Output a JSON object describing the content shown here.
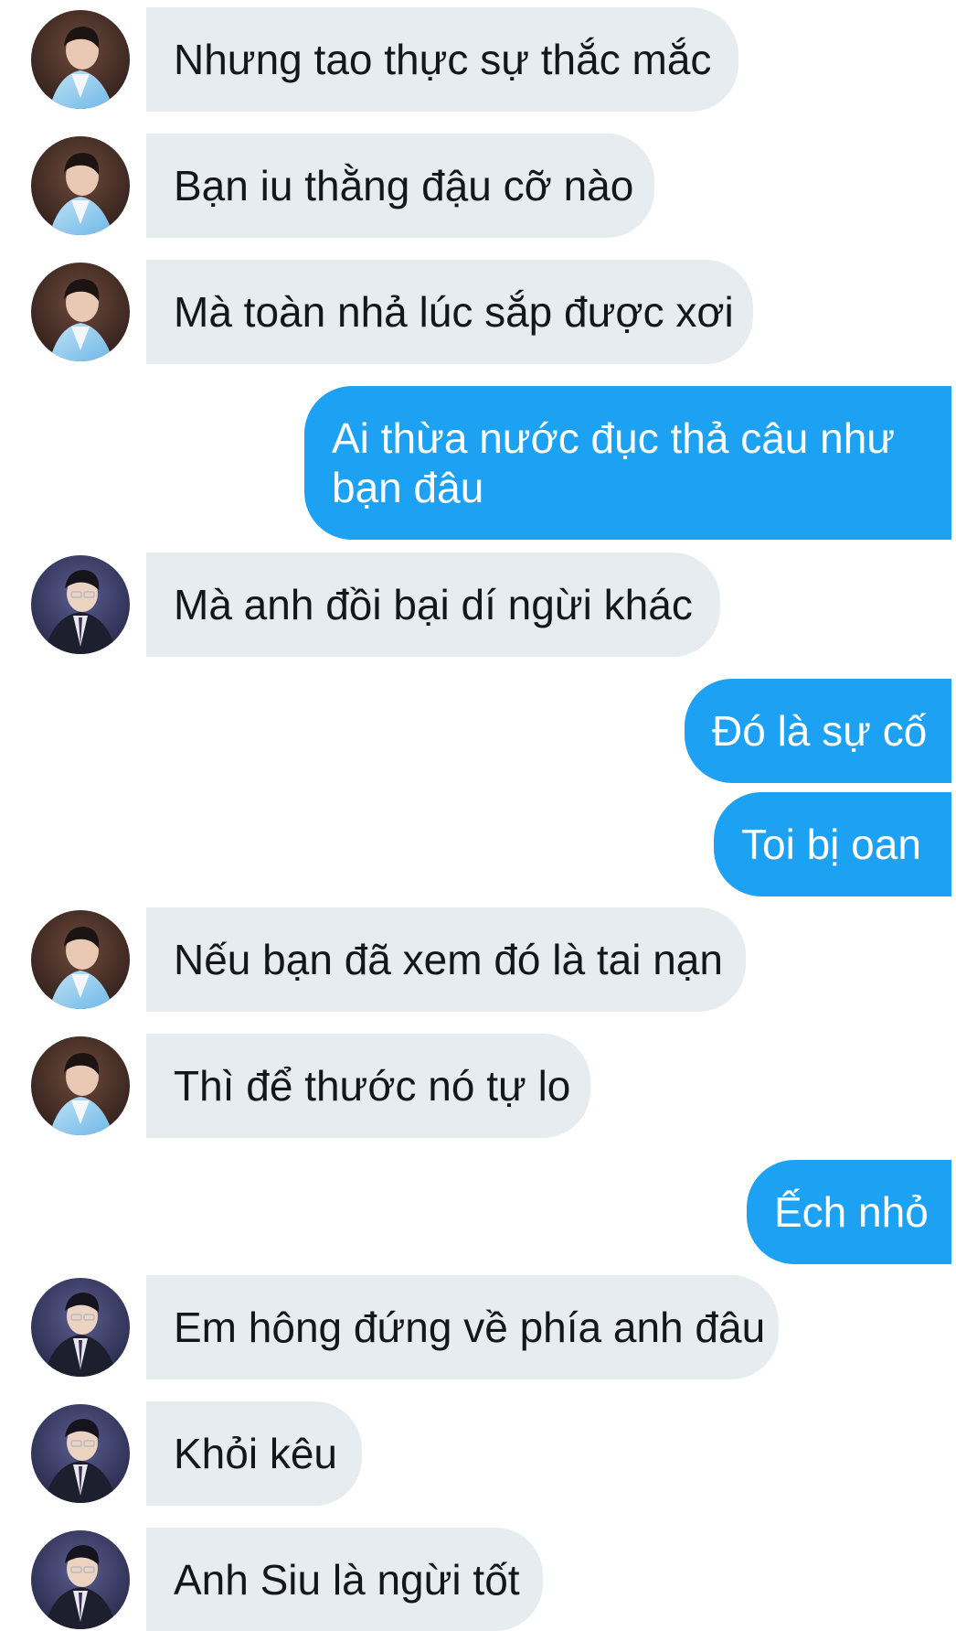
{
  "conversation": {
    "messages": [
      {
        "sender": "contact_a",
        "text": "Nhưng tao thực sự thắc mắc"
      },
      {
        "sender": "contact_a",
        "text": "Bạn iu thằng đậu cỡ nào"
      },
      {
        "sender": "contact_a",
        "text": "Mà toàn nhả lúc sắp được xơi"
      },
      {
        "sender": "me",
        "text": "Ai thừa nước đục thả câu như bạn đâu"
      },
      {
        "sender": "contact_b",
        "text": "Mà anh đồi bại dí ngừi khác"
      },
      {
        "sender": "me",
        "text": "Đó là sự cố"
      },
      {
        "sender": "me",
        "text": "Toi bị oan"
      },
      {
        "sender": "contact_a",
        "text": "Nếu bạn đã xem đó là tai nạn"
      },
      {
        "sender": "contact_a",
        "text": "Thì để thước nó tự lo"
      },
      {
        "sender": "me",
        "text": "Ếch nhỏ"
      },
      {
        "sender": "contact_b",
        "text": "Em hông đứng về phía anh đâu"
      },
      {
        "sender": "contact_b",
        "text": "Khỏi kêu"
      },
      {
        "sender": "contact_b",
        "text": "Anh Siu là ngừi tốt"
      }
    ]
  },
  "colors": {
    "incoming_bubble": "#e6ecf0",
    "outgoing_bubble": "#1da1f2",
    "incoming_text": "#14171a",
    "outgoing_text": "#ffffff"
  },
  "icons": {
    "contact_a_avatar": "person-avatar-icon",
    "contact_b_avatar": "person-avatar-icon"
  }
}
